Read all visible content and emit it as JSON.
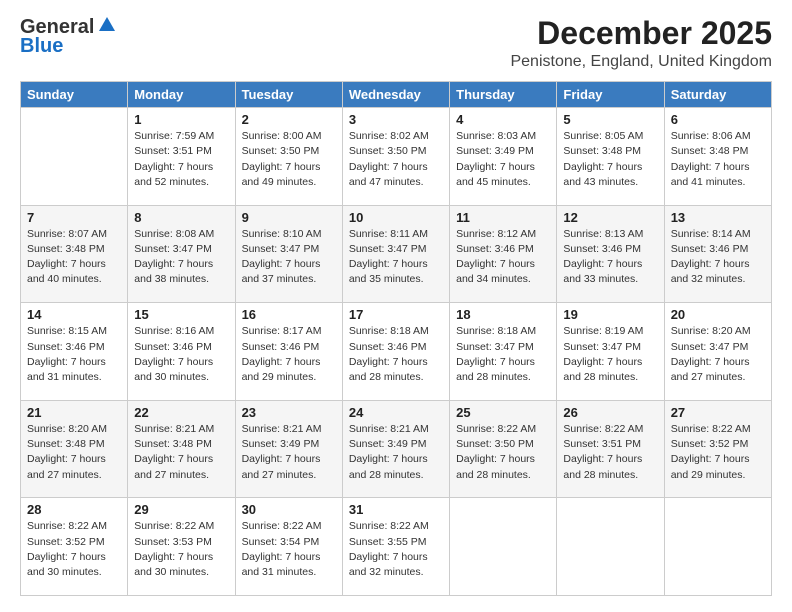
{
  "header": {
    "logo": {
      "line1": "General",
      "line2": "Blue"
    },
    "title": "December 2025",
    "location": "Penistone, England, United Kingdom"
  },
  "days_of_week": [
    "Sunday",
    "Monday",
    "Tuesday",
    "Wednesday",
    "Thursday",
    "Friday",
    "Saturday"
  ],
  "weeks": [
    [
      {
        "day": "",
        "info": ""
      },
      {
        "day": "1",
        "info": "Sunrise: 7:59 AM\nSunset: 3:51 PM\nDaylight: 7 hours\nand 52 minutes."
      },
      {
        "day": "2",
        "info": "Sunrise: 8:00 AM\nSunset: 3:50 PM\nDaylight: 7 hours\nand 49 minutes."
      },
      {
        "day": "3",
        "info": "Sunrise: 8:02 AM\nSunset: 3:50 PM\nDaylight: 7 hours\nand 47 minutes."
      },
      {
        "day": "4",
        "info": "Sunrise: 8:03 AM\nSunset: 3:49 PM\nDaylight: 7 hours\nand 45 minutes."
      },
      {
        "day": "5",
        "info": "Sunrise: 8:05 AM\nSunset: 3:48 PM\nDaylight: 7 hours\nand 43 minutes."
      },
      {
        "day": "6",
        "info": "Sunrise: 8:06 AM\nSunset: 3:48 PM\nDaylight: 7 hours\nand 41 minutes."
      }
    ],
    [
      {
        "day": "7",
        "info": "Sunrise: 8:07 AM\nSunset: 3:48 PM\nDaylight: 7 hours\nand 40 minutes."
      },
      {
        "day": "8",
        "info": "Sunrise: 8:08 AM\nSunset: 3:47 PM\nDaylight: 7 hours\nand 38 minutes."
      },
      {
        "day": "9",
        "info": "Sunrise: 8:10 AM\nSunset: 3:47 PM\nDaylight: 7 hours\nand 37 minutes."
      },
      {
        "day": "10",
        "info": "Sunrise: 8:11 AM\nSunset: 3:47 PM\nDaylight: 7 hours\nand 35 minutes."
      },
      {
        "day": "11",
        "info": "Sunrise: 8:12 AM\nSunset: 3:46 PM\nDaylight: 7 hours\nand 34 minutes."
      },
      {
        "day": "12",
        "info": "Sunrise: 8:13 AM\nSunset: 3:46 PM\nDaylight: 7 hours\nand 33 minutes."
      },
      {
        "day": "13",
        "info": "Sunrise: 8:14 AM\nSunset: 3:46 PM\nDaylight: 7 hours\nand 32 minutes."
      }
    ],
    [
      {
        "day": "14",
        "info": "Sunrise: 8:15 AM\nSunset: 3:46 PM\nDaylight: 7 hours\nand 31 minutes."
      },
      {
        "day": "15",
        "info": "Sunrise: 8:16 AM\nSunset: 3:46 PM\nDaylight: 7 hours\nand 30 minutes."
      },
      {
        "day": "16",
        "info": "Sunrise: 8:17 AM\nSunset: 3:46 PM\nDaylight: 7 hours\nand 29 minutes."
      },
      {
        "day": "17",
        "info": "Sunrise: 8:18 AM\nSunset: 3:46 PM\nDaylight: 7 hours\nand 28 minutes."
      },
      {
        "day": "18",
        "info": "Sunrise: 8:18 AM\nSunset: 3:47 PM\nDaylight: 7 hours\nand 28 minutes."
      },
      {
        "day": "19",
        "info": "Sunrise: 8:19 AM\nSunset: 3:47 PM\nDaylight: 7 hours\nand 28 minutes."
      },
      {
        "day": "20",
        "info": "Sunrise: 8:20 AM\nSunset: 3:47 PM\nDaylight: 7 hours\nand 27 minutes."
      }
    ],
    [
      {
        "day": "21",
        "info": "Sunrise: 8:20 AM\nSunset: 3:48 PM\nDaylight: 7 hours\nand 27 minutes."
      },
      {
        "day": "22",
        "info": "Sunrise: 8:21 AM\nSunset: 3:48 PM\nDaylight: 7 hours\nand 27 minutes."
      },
      {
        "day": "23",
        "info": "Sunrise: 8:21 AM\nSunset: 3:49 PM\nDaylight: 7 hours\nand 27 minutes."
      },
      {
        "day": "24",
        "info": "Sunrise: 8:21 AM\nSunset: 3:49 PM\nDaylight: 7 hours\nand 28 minutes."
      },
      {
        "day": "25",
        "info": "Sunrise: 8:22 AM\nSunset: 3:50 PM\nDaylight: 7 hours\nand 28 minutes."
      },
      {
        "day": "26",
        "info": "Sunrise: 8:22 AM\nSunset: 3:51 PM\nDaylight: 7 hours\nand 28 minutes."
      },
      {
        "day": "27",
        "info": "Sunrise: 8:22 AM\nSunset: 3:52 PM\nDaylight: 7 hours\nand 29 minutes."
      }
    ],
    [
      {
        "day": "28",
        "info": "Sunrise: 8:22 AM\nSunset: 3:52 PM\nDaylight: 7 hours\nand 30 minutes."
      },
      {
        "day": "29",
        "info": "Sunrise: 8:22 AM\nSunset: 3:53 PM\nDaylight: 7 hours\nand 30 minutes."
      },
      {
        "day": "30",
        "info": "Sunrise: 8:22 AM\nSunset: 3:54 PM\nDaylight: 7 hours\nand 31 minutes."
      },
      {
        "day": "31",
        "info": "Sunrise: 8:22 AM\nSunset: 3:55 PM\nDaylight: 7 hours\nand 32 minutes."
      },
      {
        "day": "",
        "info": ""
      },
      {
        "day": "",
        "info": ""
      },
      {
        "day": "",
        "info": ""
      }
    ]
  ]
}
